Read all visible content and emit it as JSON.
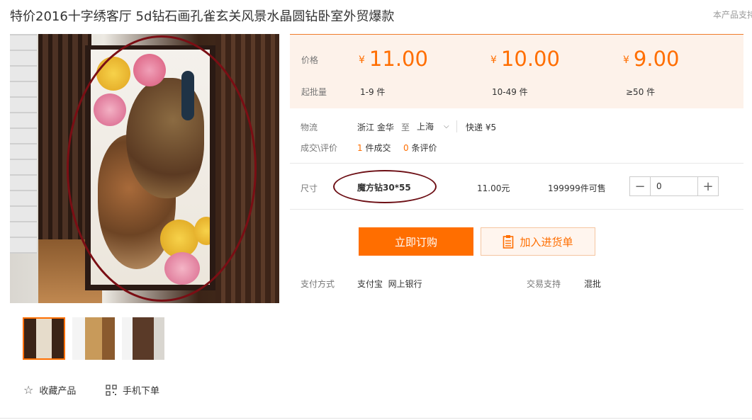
{
  "product": {
    "title": "特价2016十字绣客厅 5d钻石画孔雀玄关风景水晶圆钻卧室外贸爆款",
    "corner_link": "本产品支持"
  },
  "price_table": {
    "price_label": "价格",
    "min_qty_label": "起批量",
    "currency": "¥",
    "tiers": [
      {
        "price": "11.00",
        "qty": "1-9 件"
      },
      {
        "price": "10.00",
        "qty": "10-49 件"
      },
      {
        "price": "9.00",
        "qty": "≥50 件"
      }
    ]
  },
  "logistics": {
    "label": "物流",
    "origin": "浙江 金华",
    "to": "至",
    "destination": "上海",
    "shipping": "快递 ¥5"
  },
  "deals": {
    "label": "成交\\评价",
    "sold_count": "1",
    "sold_text": "件成交",
    "review_count": "0",
    "review_text": "条评价"
  },
  "size": {
    "label": "尺寸",
    "option": "魔方钻30*55",
    "price": "11.00元",
    "stock": "199999件可售",
    "quantity": "0"
  },
  "actions": {
    "buy_now": "立即订购",
    "add_to_list": "加入进货单"
  },
  "payment": {
    "label": "支付方式",
    "methods": "支付宝  网上银行",
    "trade_label": "交易支持",
    "trade_value": "混批"
  },
  "gallery": {
    "favorite": "收藏产品",
    "mobile_order": "手机下单"
  },
  "colors": {
    "accent": "#ff6e00",
    "price_bg": "#fdf2ea",
    "annotation": "#7a0e14"
  }
}
